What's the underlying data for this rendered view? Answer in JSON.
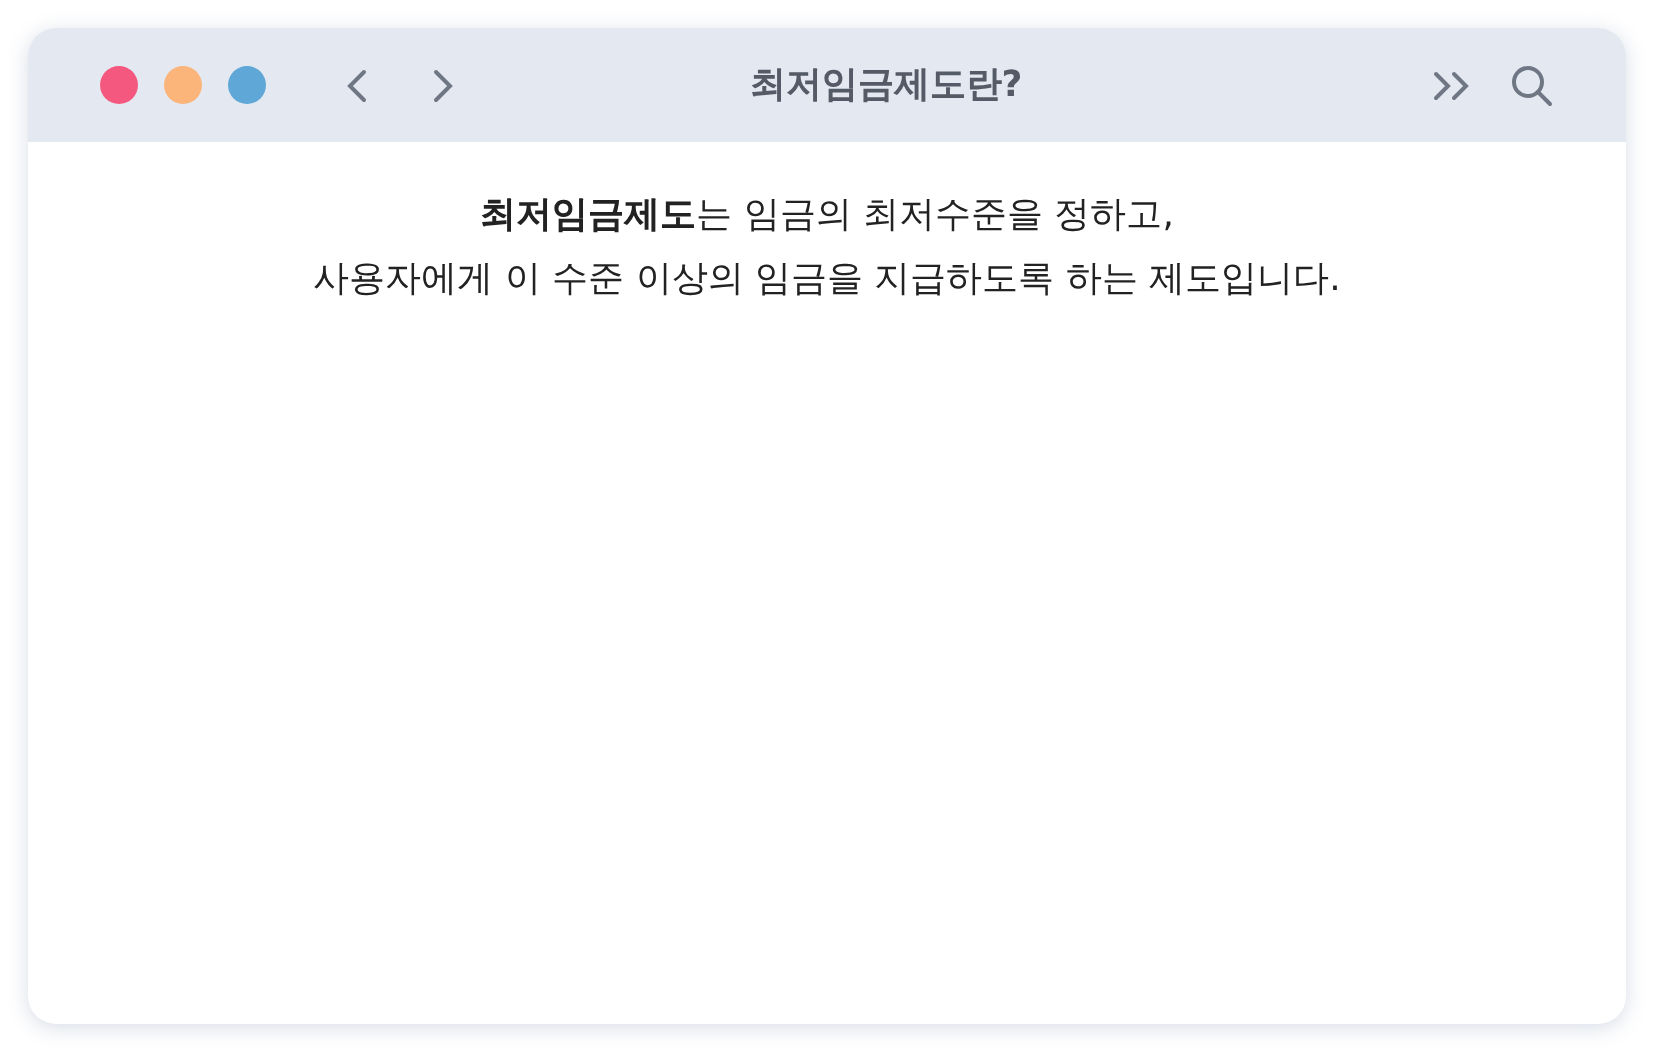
{
  "window": {
    "title": "최저임금제도란?"
  },
  "body": {
    "lines": [
      "**최저임금제도**는 임금의 최저수준을 정하고,",
      "사용자에게 이 수준 이상의 임금을 지급하도록 하는 제도입니다."
    ]
  }
}
